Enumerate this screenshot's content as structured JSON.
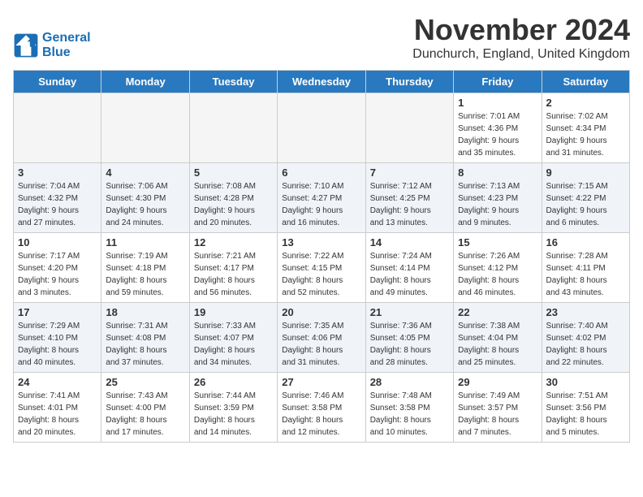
{
  "logo": {
    "line1": "General",
    "line2": "Blue"
  },
  "title": "November 2024",
  "location": "Dunchurch, England, United Kingdom",
  "headers": [
    "Sunday",
    "Monday",
    "Tuesday",
    "Wednesday",
    "Thursday",
    "Friday",
    "Saturday"
  ],
  "weeks": [
    [
      {
        "day": "",
        "info": ""
      },
      {
        "day": "",
        "info": ""
      },
      {
        "day": "",
        "info": ""
      },
      {
        "day": "",
        "info": ""
      },
      {
        "day": "",
        "info": ""
      },
      {
        "day": "1",
        "info": "Sunrise: 7:01 AM\nSunset: 4:36 PM\nDaylight: 9 hours\nand 35 minutes."
      },
      {
        "day": "2",
        "info": "Sunrise: 7:02 AM\nSunset: 4:34 PM\nDaylight: 9 hours\nand 31 minutes."
      }
    ],
    [
      {
        "day": "3",
        "info": "Sunrise: 7:04 AM\nSunset: 4:32 PM\nDaylight: 9 hours\nand 27 minutes."
      },
      {
        "day": "4",
        "info": "Sunrise: 7:06 AM\nSunset: 4:30 PM\nDaylight: 9 hours\nand 24 minutes."
      },
      {
        "day": "5",
        "info": "Sunrise: 7:08 AM\nSunset: 4:28 PM\nDaylight: 9 hours\nand 20 minutes."
      },
      {
        "day": "6",
        "info": "Sunrise: 7:10 AM\nSunset: 4:27 PM\nDaylight: 9 hours\nand 16 minutes."
      },
      {
        "day": "7",
        "info": "Sunrise: 7:12 AM\nSunset: 4:25 PM\nDaylight: 9 hours\nand 13 minutes."
      },
      {
        "day": "8",
        "info": "Sunrise: 7:13 AM\nSunset: 4:23 PM\nDaylight: 9 hours\nand 9 minutes."
      },
      {
        "day": "9",
        "info": "Sunrise: 7:15 AM\nSunset: 4:22 PM\nDaylight: 9 hours\nand 6 minutes."
      }
    ],
    [
      {
        "day": "10",
        "info": "Sunrise: 7:17 AM\nSunset: 4:20 PM\nDaylight: 9 hours\nand 3 minutes."
      },
      {
        "day": "11",
        "info": "Sunrise: 7:19 AM\nSunset: 4:18 PM\nDaylight: 8 hours\nand 59 minutes."
      },
      {
        "day": "12",
        "info": "Sunrise: 7:21 AM\nSunset: 4:17 PM\nDaylight: 8 hours\nand 56 minutes."
      },
      {
        "day": "13",
        "info": "Sunrise: 7:22 AM\nSunset: 4:15 PM\nDaylight: 8 hours\nand 52 minutes."
      },
      {
        "day": "14",
        "info": "Sunrise: 7:24 AM\nSunset: 4:14 PM\nDaylight: 8 hours\nand 49 minutes."
      },
      {
        "day": "15",
        "info": "Sunrise: 7:26 AM\nSunset: 4:12 PM\nDaylight: 8 hours\nand 46 minutes."
      },
      {
        "day": "16",
        "info": "Sunrise: 7:28 AM\nSunset: 4:11 PM\nDaylight: 8 hours\nand 43 minutes."
      }
    ],
    [
      {
        "day": "17",
        "info": "Sunrise: 7:29 AM\nSunset: 4:10 PM\nDaylight: 8 hours\nand 40 minutes."
      },
      {
        "day": "18",
        "info": "Sunrise: 7:31 AM\nSunset: 4:08 PM\nDaylight: 8 hours\nand 37 minutes."
      },
      {
        "day": "19",
        "info": "Sunrise: 7:33 AM\nSunset: 4:07 PM\nDaylight: 8 hours\nand 34 minutes."
      },
      {
        "day": "20",
        "info": "Sunrise: 7:35 AM\nSunset: 4:06 PM\nDaylight: 8 hours\nand 31 minutes."
      },
      {
        "day": "21",
        "info": "Sunrise: 7:36 AM\nSunset: 4:05 PM\nDaylight: 8 hours\nand 28 minutes."
      },
      {
        "day": "22",
        "info": "Sunrise: 7:38 AM\nSunset: 4:04 PM\nDaylight: 8 hours\nand 25 minutes."
      },
      {
        "day": "23",
        "info": "Sunrise: 7:40 AM\nSunset: 4:02 PM\nDaylight: 8 hours\nand 22 minutes."
      }
    ],
    [
      {
        "day": "24",
        "info": "Sunrise: 7:41 AM\nSunset: 4:01 PM\nDaylight: 8 hours\nand 20 minutes."
      },
      {
        "day": "25",
        "info": "Sunrise: 7:43 AM\nSunset: 4:00 PM\nDaylight: 8 hours\nand 17 minutes."
      },
      {
        "day": "26",
        "info": "Sunrise: 7:44 AM\nSunset: 3:59 PM\nDaylight: 8 hours\nand 14 minutes."
      },
      {
        "day": "27",
        "info": "Sunrise: 7:46 AM\nSunset: 3:58 PM\nDaylight: 8 hours\nand 12 minutes."
      },
      {
        "day": "28",
        "info": "Sunrise: 7:48 AM\nSunset: 3:58 PM\nDaylight: 8 hours\nand 10 minutes."
      },
      {
        "day": "29",
        "info": "Sunrise: 7:49 AM\nSunset: 3:57 PM\nDaylight: 8 hours\nand 7 minutes."
      },
      {
        "day": "30",
        "info": "Sunrise: 7:51 AM\nSunset: 3:56 PM\nDaylight: 8 hours\nand 5 minutes."
      }
    ]
  ]
}
